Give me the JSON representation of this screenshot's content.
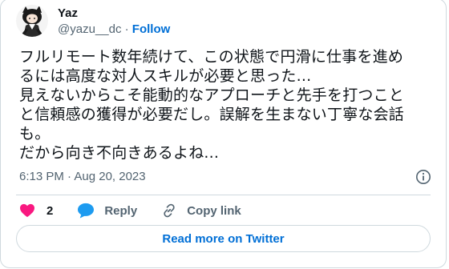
{
  "tweet": {
    "author": {
      "display_name": "Yaz",
      "handle": "@yazu__dc",
      "separator": " · ",
      "follow_label": "Follow"
    },
    "text_lines": [
      "フルリモート数年続けて、この状態で円滑に仕事を進め",
      "るには高度な対人スキルが必要と思った...",
      "見えないからこそ能動的なアプローチと先手を打つこと",
      "と信頼感の獲得が必要だし。誤解を生まない丁寧な会話",
      "も。",
      "だから向き不向きあるよね..."
    ],
    "timestamp": "6:13 PM · Aug 20, 2023",
    "actions": {
      "like_count": "2",
      "reply_label": "Reply",
      "copy_link_label": "Copy link"
    },
    "read_more_label": "Read more on Twitter"
  },
  "colors": {
    "text": "#0f1419",
    "secondary": "#536471",
    "accent": "#006fd6",
    "like": "#f91880",
    "reply": "#1d9bf0",
    "border": "#cfd9de"
  },
  "icons": [
    "avatar-image",
    "heart-icon",
    "speech-bubble-icon",
    "link-icon",
    "info-icon"
  ]
}
